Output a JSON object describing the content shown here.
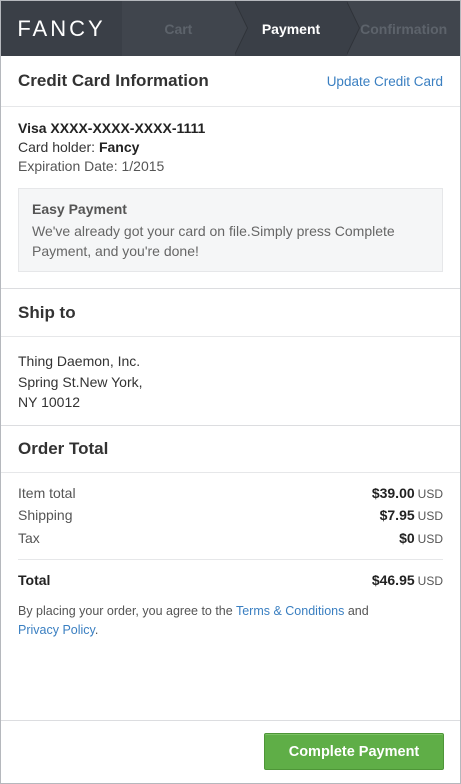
{
  "header": {
    "logo": "FANCY",
    "steps": [
      {
        "label": "Cart"
      },
      {
        "label": "Payment"
      },
      {
        "label": "Confirmation"
      }
    ]
  },
  "credit_card": {
    "title": "Credit Card Information",
    "update_link": "Update Credit Card",
    "card_line": "Visa XXXX-XXXX-XXXX-1111",
    "holder_label": "Card holder:",
    "holder_name": "Fancy",
    "expiration": "Expiration Date: 1/2015",
    "easy_payment": {
      "title": "Easy Payment",
      "text": "We've already got your card on file.Simply press Complete Payment, and you're done!"
    }
  },
  "ship_to": {
    "title": "Ship to",
    "lines": [
      "Thing Daemon, Inc.",
      "Spring St.New York,",
      "NY 10012"
    ]
  },
  "order_total": {
    "title": "Order Total",
    "rows": [
      {
        "label": "Item total",
        "amount": "$39.00",
        "currency": "USD"
      },
      {
        "label": "Shipping",
        "amount": "$7.95",
        "currency": "USD"
      },
      {
        "label": "Tax",
        "amount": "$0",
        "currency": "USD"
      }
    ],
    "total_label": "Total",
    "total_amount": "$46.95",
    "total_currency": "USD"
  },
  "terms": {
    "prefix": "By placing your order, you agree to the ",
    "terms_link": "Terms & Conditions",
    "middle": " and",
    "privacy_link": "Privacy Policy",
    "suffix": "."
  },
  "footer": {
    "button_label": "Complete Payment"
  }
}
